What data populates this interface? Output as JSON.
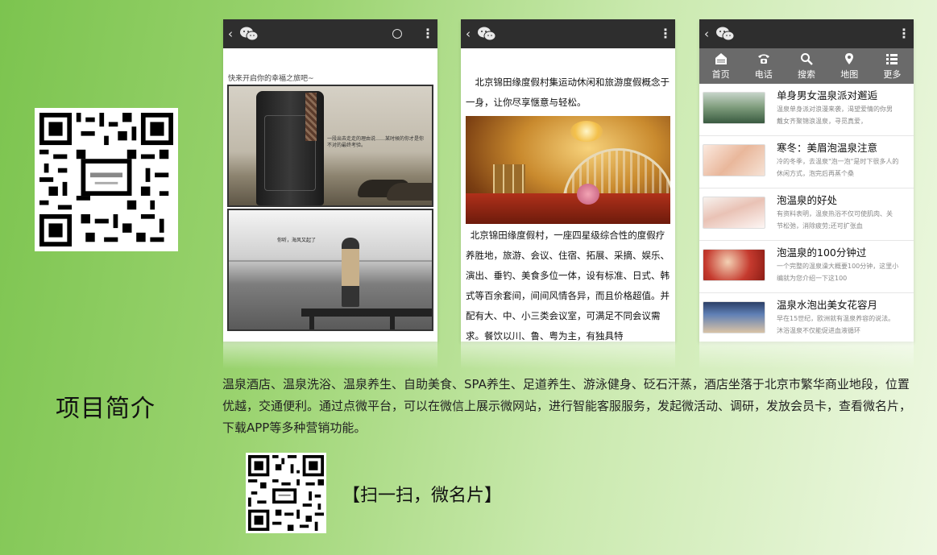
{
  "phones": {
    "article_page": {
      "caption": "快来开启你的幸福之旅吧~",
      "image1_text": "一段出去走走的理由说……某时候的你才是你不对的最终考验。",
      "image2_text": "你听，海风又起了"
    },
    "resort_page": {
      "intro": "北京锦田缘度假村集运动休闲和旅游度假概念于一身，让你尽享惬意与轻松。",
      "body": "北京锦田缘度假村，一座四星级综合性的度假疗养胜地，旅游、会议、住宿、拓展、采摘、娱乐、演出、垂钓、美食多位一体，设有标准、日式、韩式等百余套间，间间风情各异，而且价格超值。并配有大、中、小三类会议室，可满足不同会议需求。餐饮以川、鲁、粤为主，有独具特"
    },
    "list_page": {
      "nav": [
        {
          "label": "首页",
          "icon": "home-icon"
        },
        {
          "label": "电话",
          "icon": "phone-icon"
        },
        {
          "label": "搜索",
          "icon": "search-icon"
        },
        {
          "label": "地图",
          "icon": "map-pin-icon"
        },
        {
          "label": "更多",
          "icon": "list-icon"
        }
      ],
      "articles": [
        {
          "title": "单身男女温泉派对邂逅",
          "desc1": "温泉单身派对浪漫来袭，渴望爱情的你男",
          "desc2": "戴女齐聚锦浪温泉，寻觅真爱，"
        },
        {
          "title": "寒冬：美眉泡温泉注意",
          "desc1": "冷的冬季，去温泉\"泡一泡\"是时下很多人的",
          "desc2": "休闲方式，泡完后再蒸个桑"
        },
        {
          "title": "泡温泉的好处",
          "desc1": "有资料表明，温泉热浴不仅可使肌肉、关",
          "desc2": "节松弛，消除疲劳;还可扩张血"
        },
        {
          "title": "泡温泉的100分钟过",
          "desc1": "一个完整的温泉澡大概要100分钟，这里小",
          "desc2": "编就为您介绍一下这100"
        },
        {
          "title": "温泉水泡出美女花容月",
          "desc1": "早在15世纪，欧洲就有温泉养容的说法。",
          "desc2": "沐浴温泉不仅能促进血液循环"
        }
      ]
    }
  },
  "section_title": "项目简介",
  "description": "温泉酒店、温泉洗浴、温泉养生、自助美食、SPA养生、足道养生、游泳健身、砭石汗蒸，酒店坐落于北京市繁华商业地段，位置优越，交通便利。通过点微平台，可以在微信上展示微网站，进行智能客服服务，发起微活动、调研，发放会员卡，查看微名片，下载APP等多种营销功能。",
  "scan_label": "【扫一扫，微名片】"
}
